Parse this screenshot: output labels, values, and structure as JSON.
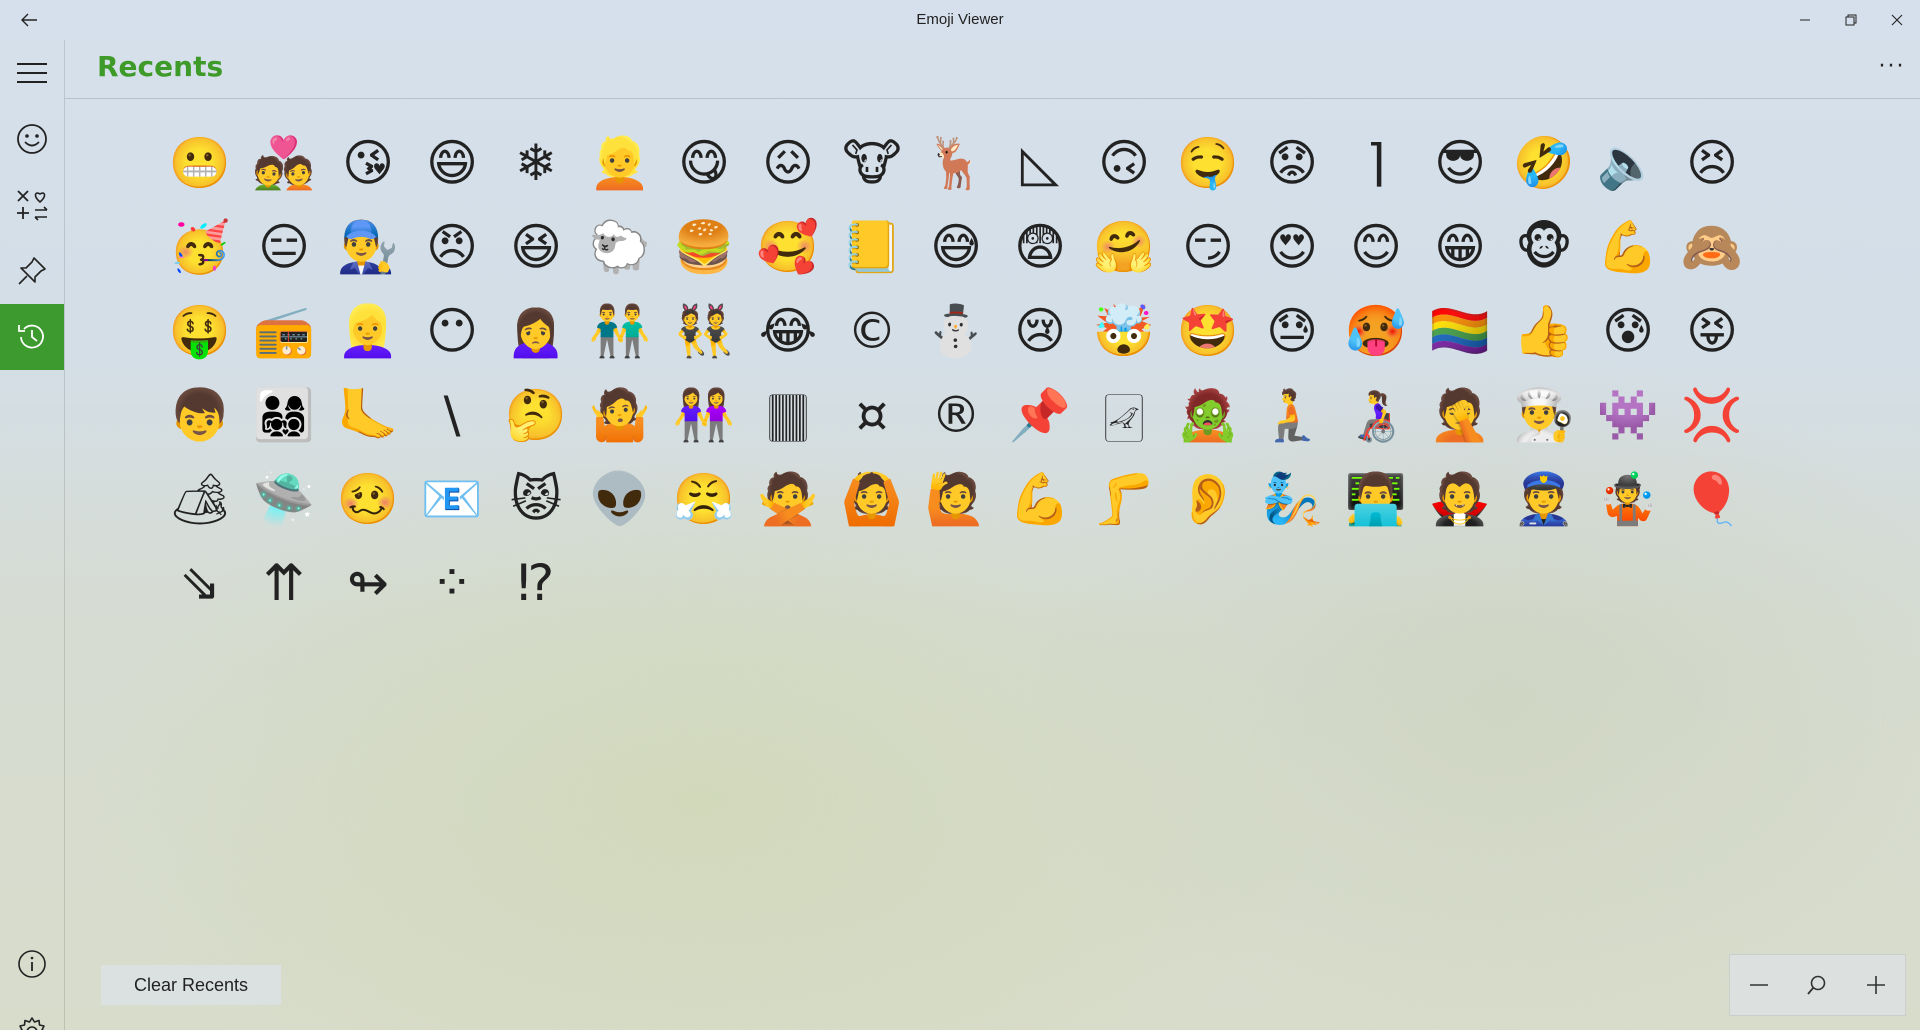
{
  "window": {
    "title": "Emoji Viewer",
    "back_icon": "←",
    "minimize_icon": "—",
    "restore_icon": "❐",
    "close_icon": "✕"
  },
  "sidebar": {
    "items": [
      {
        "name": "menu",
        "icon": "hamburger-icon"
      },
      {
        "name": "emoji",
        "icon": "smiley-icon"
      },
      {
        "name": "symbols",
        "icon": "symbols-icon"
      },
      {
        "name": "pinned",
        "icon": "pin-icon"
      },
      {
        "name": "recents",
        "icon": "history-icon",
        "active": true
      },
      {
        "name": "about",
        "icon": "info-icon"
      },
      {
        "name": "settings",
        "icon": "gear-icon"
      }
    ]
  },
  "header": {
    "title": "Recents",
    "more_label": "···"
  },
  "emoji_grid": {
    "rows": [
      [
        "😬",
        "💑",
        "😘",
        "😄",
        "❄",
        "👱",
        "😋",
        "😖",
        "🐮",
        "🦌",
        "◺",
        "🙃",
        "🤤",
        "😟",
        "⌉",
        "😎",
        "🤣",
        "🔈",
        "😣"
      ],
      [
        "🥳",
        "😑",
        "👨‍🔧",
        "😠",
        "😆",
        "🐑",
        "🍔",
        "🥰",
        "📒",
        "😅",
        "😨",
        "🤗",
        "😏",
        "😍",
        "😊",
        "😁",
        "🐵",
        "💪",
        "🙈"
      ],
      [
        "🤑",
        "📻",
        "👱‍♀️",
        "😶",
        "🙍‍♀️",
        "👬",
        "👯",
        "😂",
        "©",
        "⛄",
        "😢",
        "🤯",
        "🤩",
        "😓",
        "🥵",
        "🏳️‍🌈",
        "👍",
        "😰",
        "😝"
      ],
      [
        "👦",
        "👨‍👩‍👧‍👦",
        "🦶",
        "\\",
        "🤔",
        "🤷",
        "👭",
        "🀫",
        "¤",
        "®",
        "📌",
        "🀐",
        "🧟",
        "🧎",
        "👩‍🦽",
        "🤦",
        "👨‍🍳",
        "👾",
        "💢"
      ],
      [
        "🏕",
        "🛸",
        "🥴",
        "📧",
        "😾",
        "👽",
        "😤",
        "🙅",
        "🙆",
        "🙋",
        "💪",
        "🦵",
        "👂",
        "🧞",
        "👨‍💻",
        "🧛",
        "👮",
        "🤹",
        "🎈"
      ],
      [
        "⇘",
        "⇈",
        "↬",
        "⁘",
        "⁉"
      ]
    ]
  },
  "footer": {
    "clear_label": "Clear Recents",
    "zoom_out_icon": "−",
    "zoom_reset_icon": "⌕",
    "zoom_in_icon": "+"
  }
}
